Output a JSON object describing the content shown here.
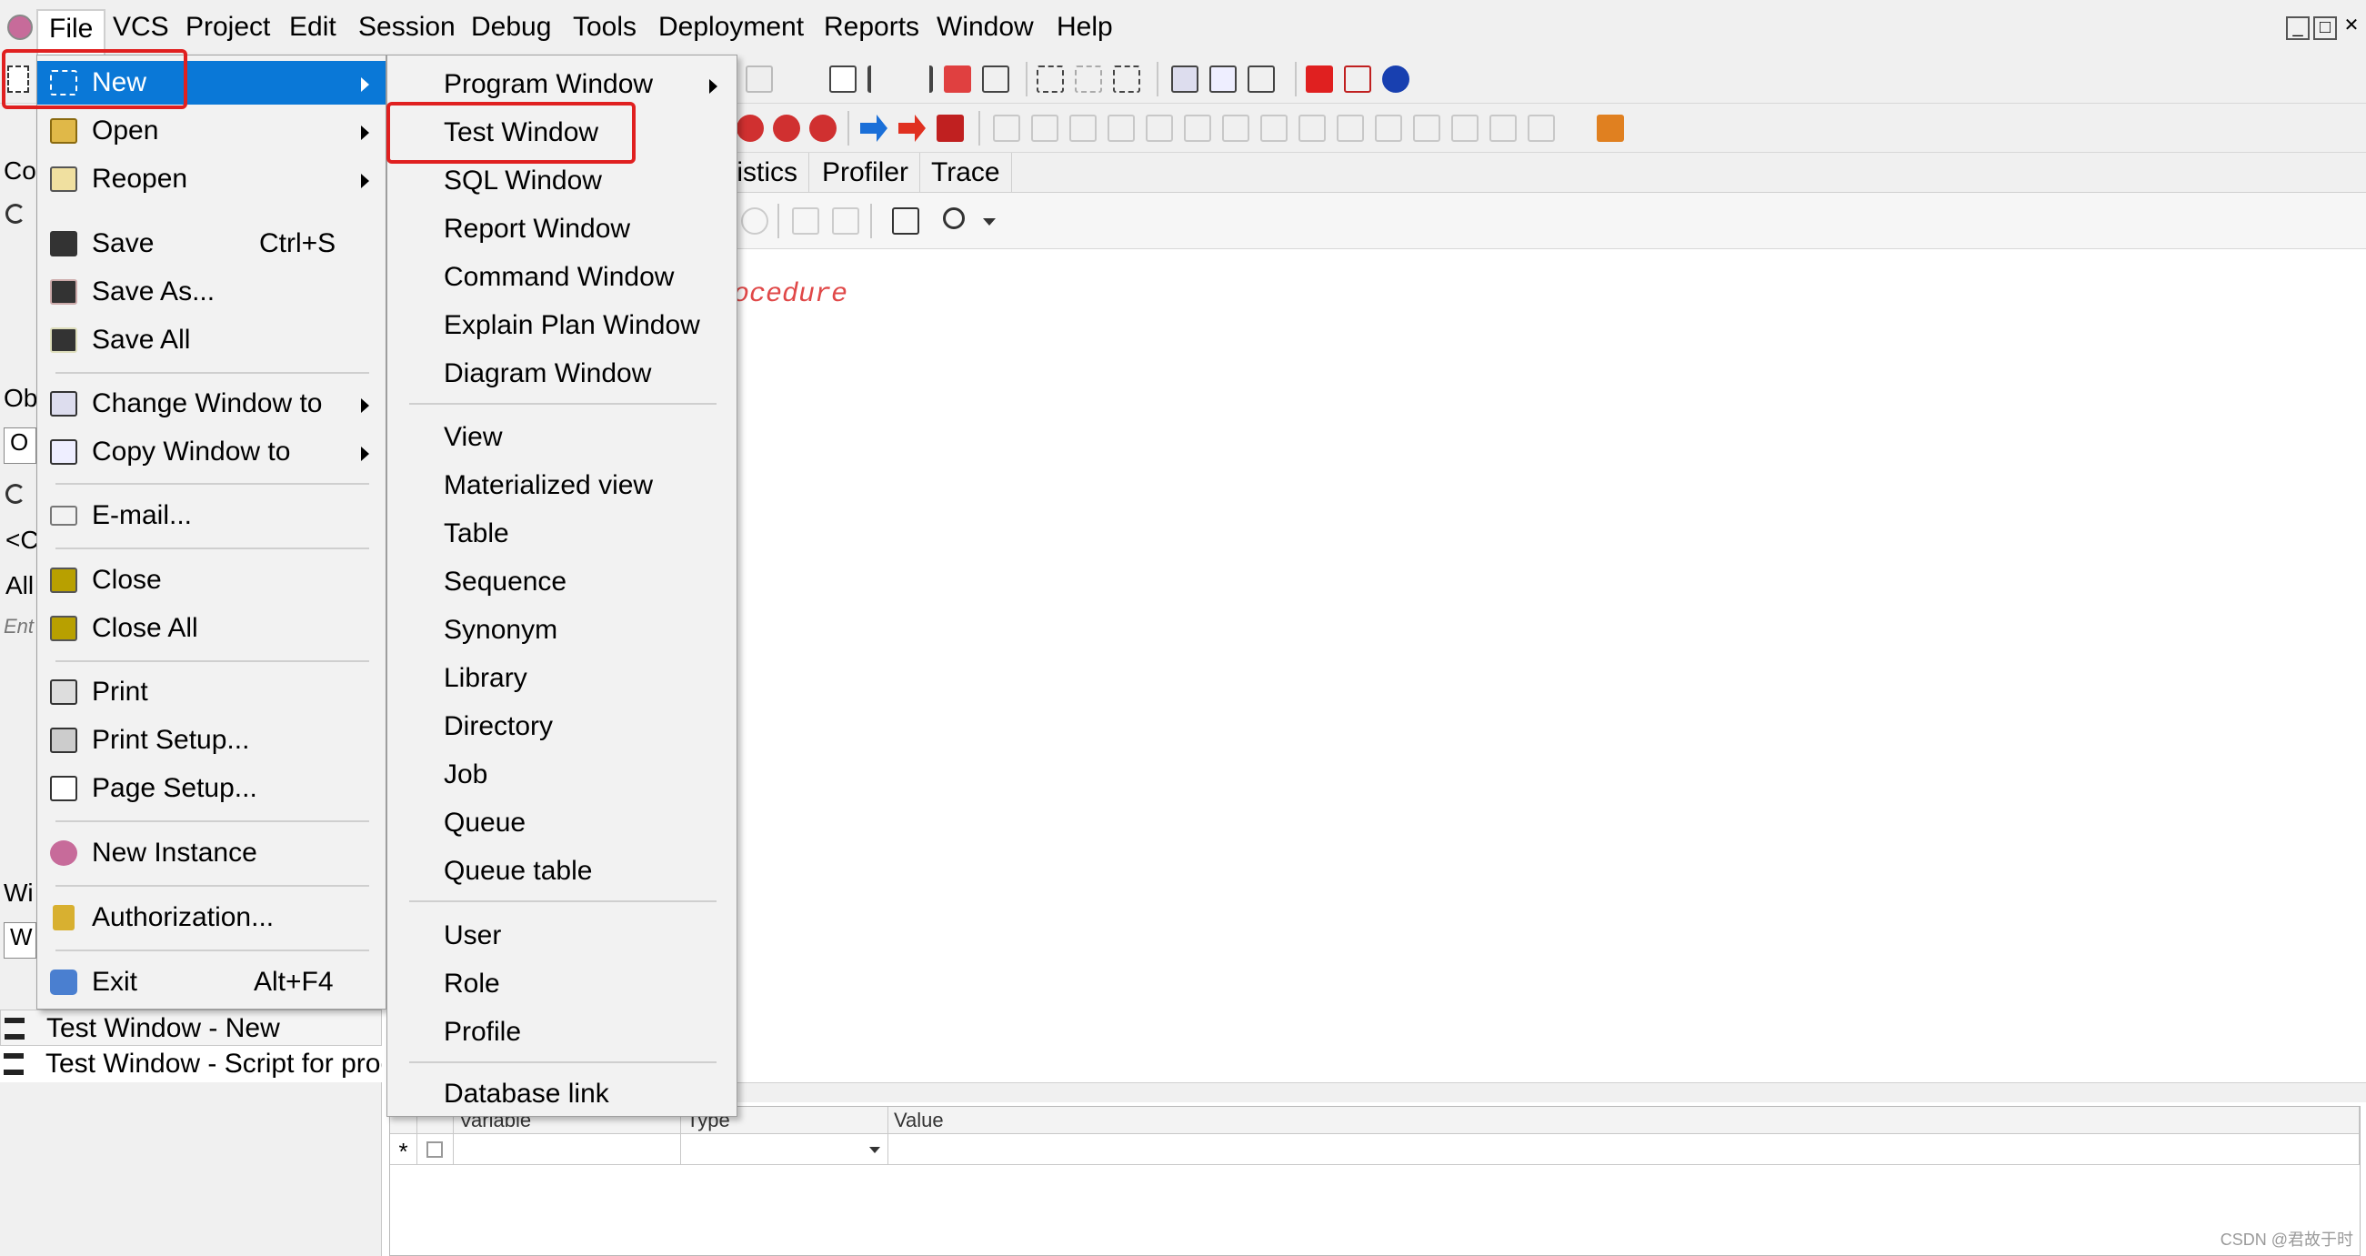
{
  "menubar": {
    "items": [
      "File",
      "VCS",
      "Project",
      "Edit",
      "Session",
      "Debug",
      "Tools",
      "Deployment",
      "Reports",
      "Window",
      "Help"
    ]
  },
  "window_controls": [
    "_",
    "□",
    "✕"
  ],
  "tabs": [
    "tistics",
    "Profiler",
    "Trace"
  ],
  "editor": {
    "code_fragment": "ocedure"
  },
  "left_panel": {
    "labels": [
      "Co",
      "Ob",
      "O",
      "<C",
      "All",
      "Ent",
      "Wi",
      "W"
    ]
  },
  "window_list": [
    "Test Window - New",
    "Test Window - Script for proc"
  ],
  "grid": {
    "headers": [
      "Variable",
      "Type",
      "Value"
    ],
    "new_row_marker": "*"
  },
  "file_menu": {
    "items": [
      {
        "label": "New",
        "submenu": true,
        "highlighted": true,
        "icon": "new-icon"
      },
      {
        "label": "Open",
        "submenu": true,
        "icon": "open-icon"
      },
      {
        "label": "Reopen",
        "submenu": true,
        "icon": "reopen-icon"
      },
      {
        "label": "Save",
        "shortcut": "Ctrl+S",
        "icon": "save-icon"
      },
      {
        "label": "Save As...",
        "icon": "save-as-icon"
      },
      {
        "label": "Save All",
        "icon": "save-all-icon"
      },
      {
        "label": "Change Window to",
        "submenu": true,
        "icon": "change-window-icon"
      },
      {
        "label": "Copy Window to",
        "submenu": true,
        "icon": "copy-window-icon"
      },
      {
        "label": "E-mail...",
        "icon": "email-icon"
      },
      {
        "label": "Close",
        "icon": "close-folder-icon"
      },
      {
        "label": "Close All",
        "icon": "close-all-icon"
      },
      {
        "label": "Print",
        "icon": "print-icon"
      },
      {
        "label": "Print Setup...",
        "icon": "print-setup-icon"
      },
      {
        "label": "Page Setup...",
        "icon": "page-setup-icon"
      },
      {
        "label": "New Instance",
        "icon": "new-instance-icon"
      },
      {
        "label": "Authorization...",
        "icon": "lock-icon"
      },
      {
        "label": "Exit",
        "shortcut": "Alt+F4",
        "icon": "exit-icon"
      }
    ]
  },
  "new_submenu": {
    "items": [
      {
        "label": "Program Window",
        "submenu": true
      },
      {
        "label": "Test Window",
        "boxed": true
      },
      {
        "label": "SQL Window"
      },
      {
        "label": "Report Window"
      },
      {
        "label": "Command Window"
      },
      {
        "label": "Explain Plan Window"
      },
      {
        "label": "Diagram Window"
      },
      {
        "label": "View"
      },
      {
        "label": "Materialized view"
      },
      {
        "label": "Table"
      },
      {
        "label": "Sequence"
      },
      {
        "label": "Synonym"
      },
      {
        "label": "Library"
      },
      {
        "label": "Directory"
      },
      {
        "label": "Job"
      },
      {
        "label": "Queue"
      },
      {
        "label": "Queue table"
      },
      {
        "label": "User"
      },
      {
        "label": "Role"
      },
      {
        "label": "Profile"
      },
      {
        "label": "Database link"
      }
    ]
  },
  "colors": {
    "highlight": "#0a78d7",
    "annotation": "#e02020",
    "code": "#e04848"
  },
  "watermark": "CSDN @君故于时"
}
